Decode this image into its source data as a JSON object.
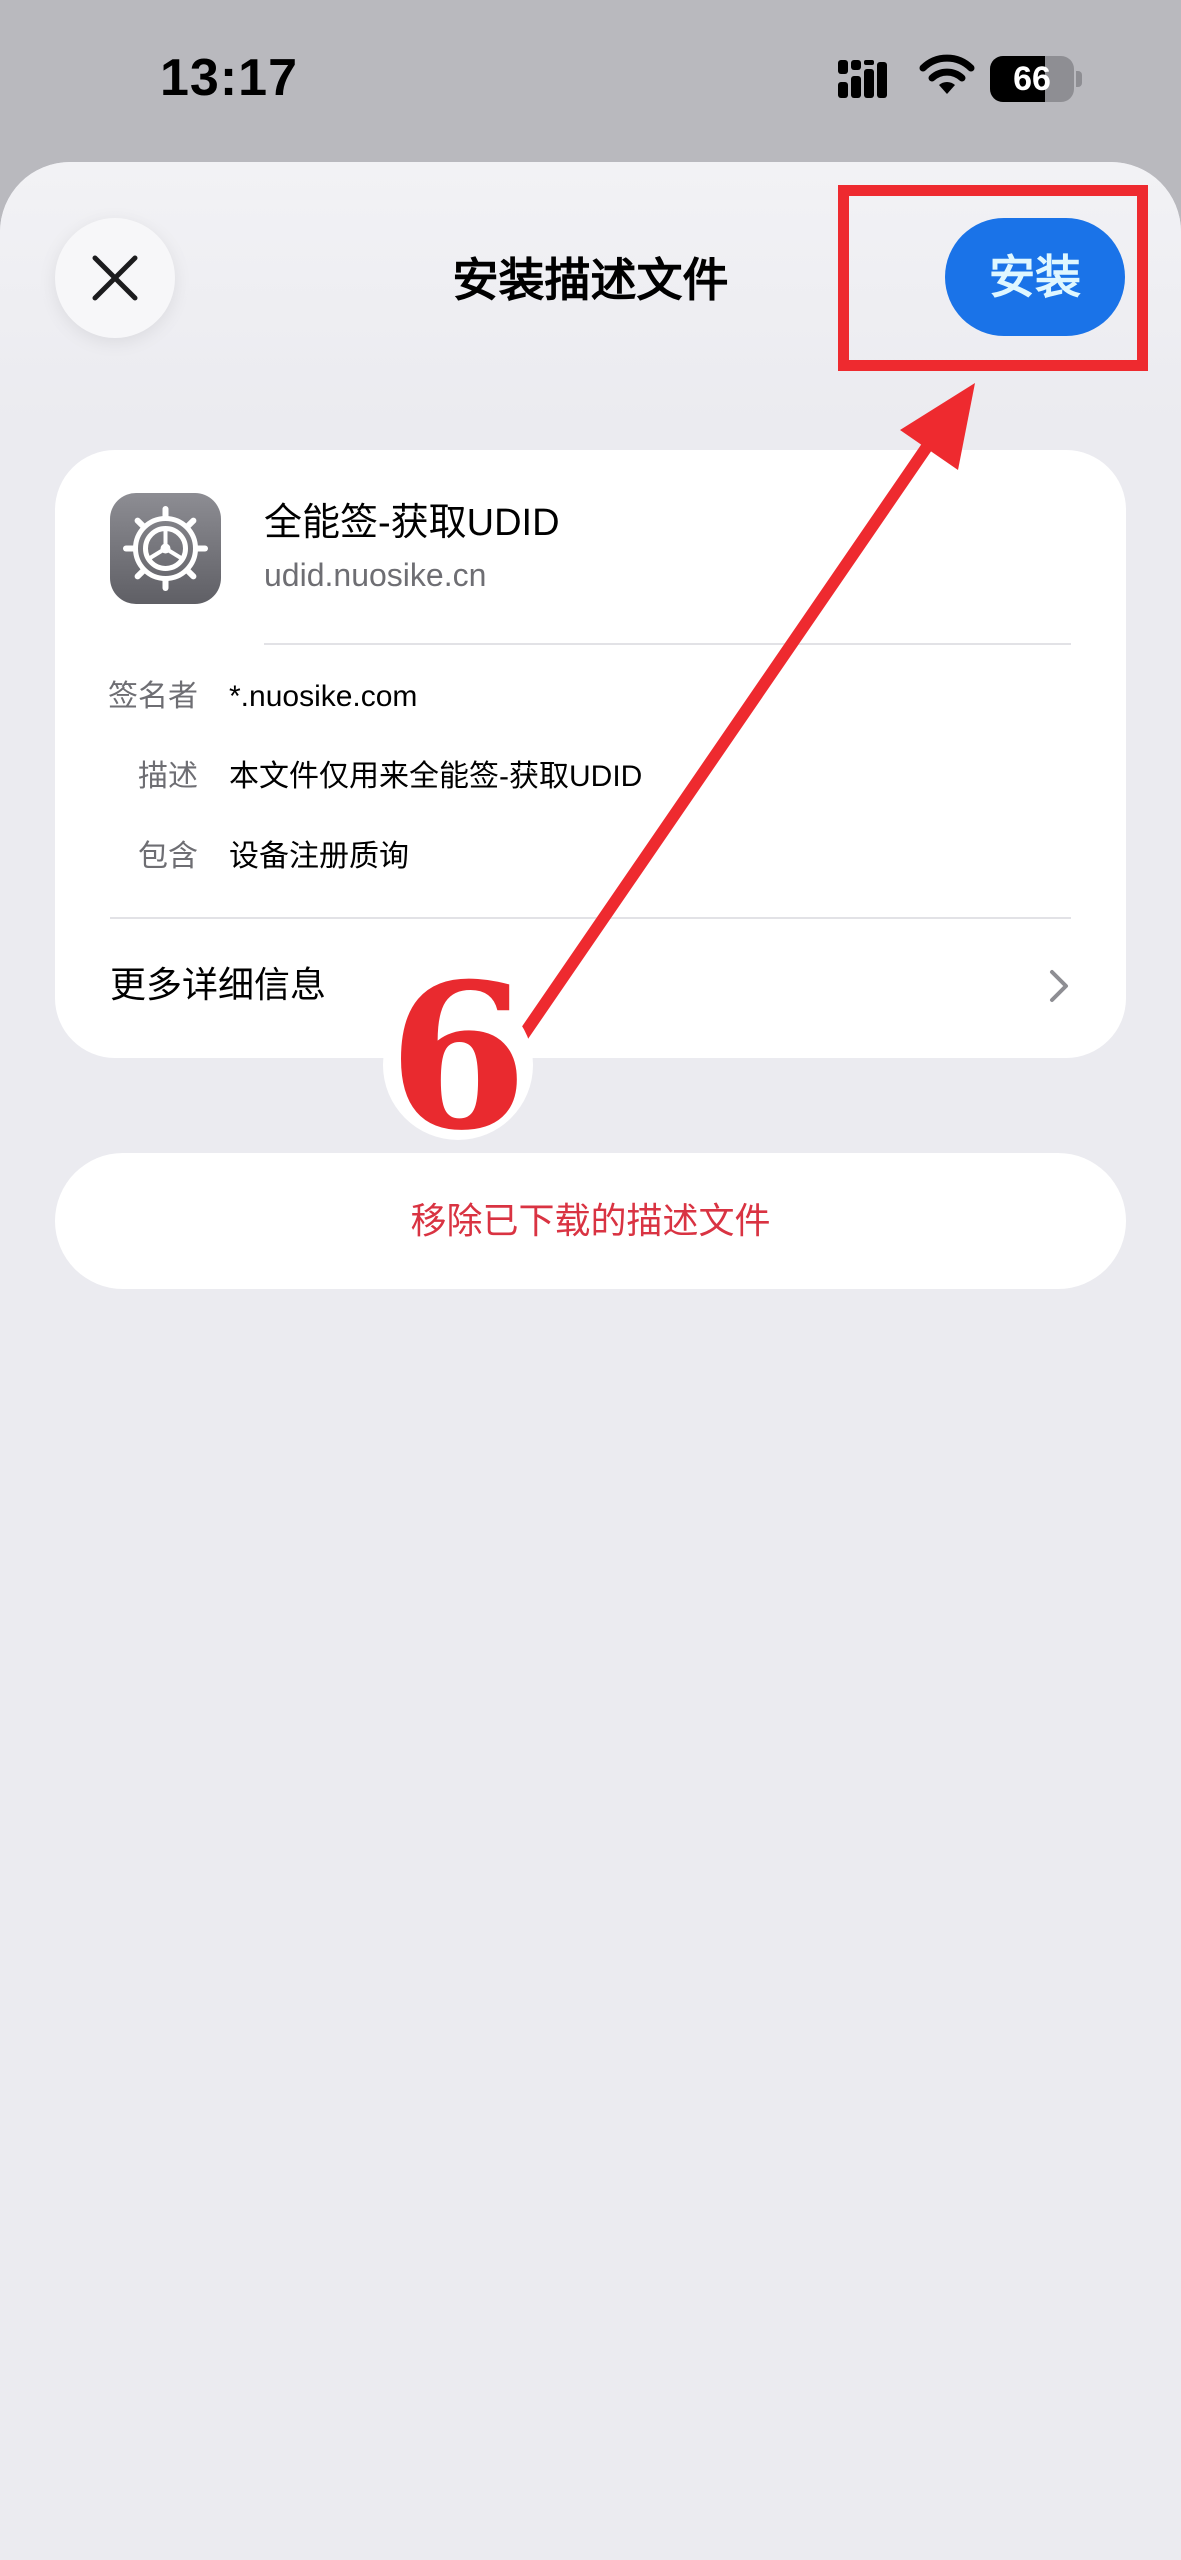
{
  "status_bar": {
    "time": "13:17",
    "battery_percent": "66",
    "battery_level": 0.66
  },
  "sheet": {
    "title": "安装描述文件",
    "install_label": "安装"
  },
  "profile": {
    "name": "全能签-获取UDID",
    "domain": "udid.nuosike.cn",
    "icon": "settings-gear-icon",
    "details": [
      {
        "label": "签名者",
        "value": "*.nuosike.com"
      },
      {
        "label": "描述",
        "value": "本文件仅用来全能签-获取UDID"
      },
      {
        "label": "包含",
        "value": "设备注册质询"
      }
    ],
    "more_info_label": "更多详细信息"
  },
  "remove_label": "移除已下载的描述文件",
  "annotation": {
    "step_number": "6",
    "color": "#ee2a2f"
  },
  "colors": {
    "accent": "#1a73e8",
    "destructive": "#d93342"
  }
}
